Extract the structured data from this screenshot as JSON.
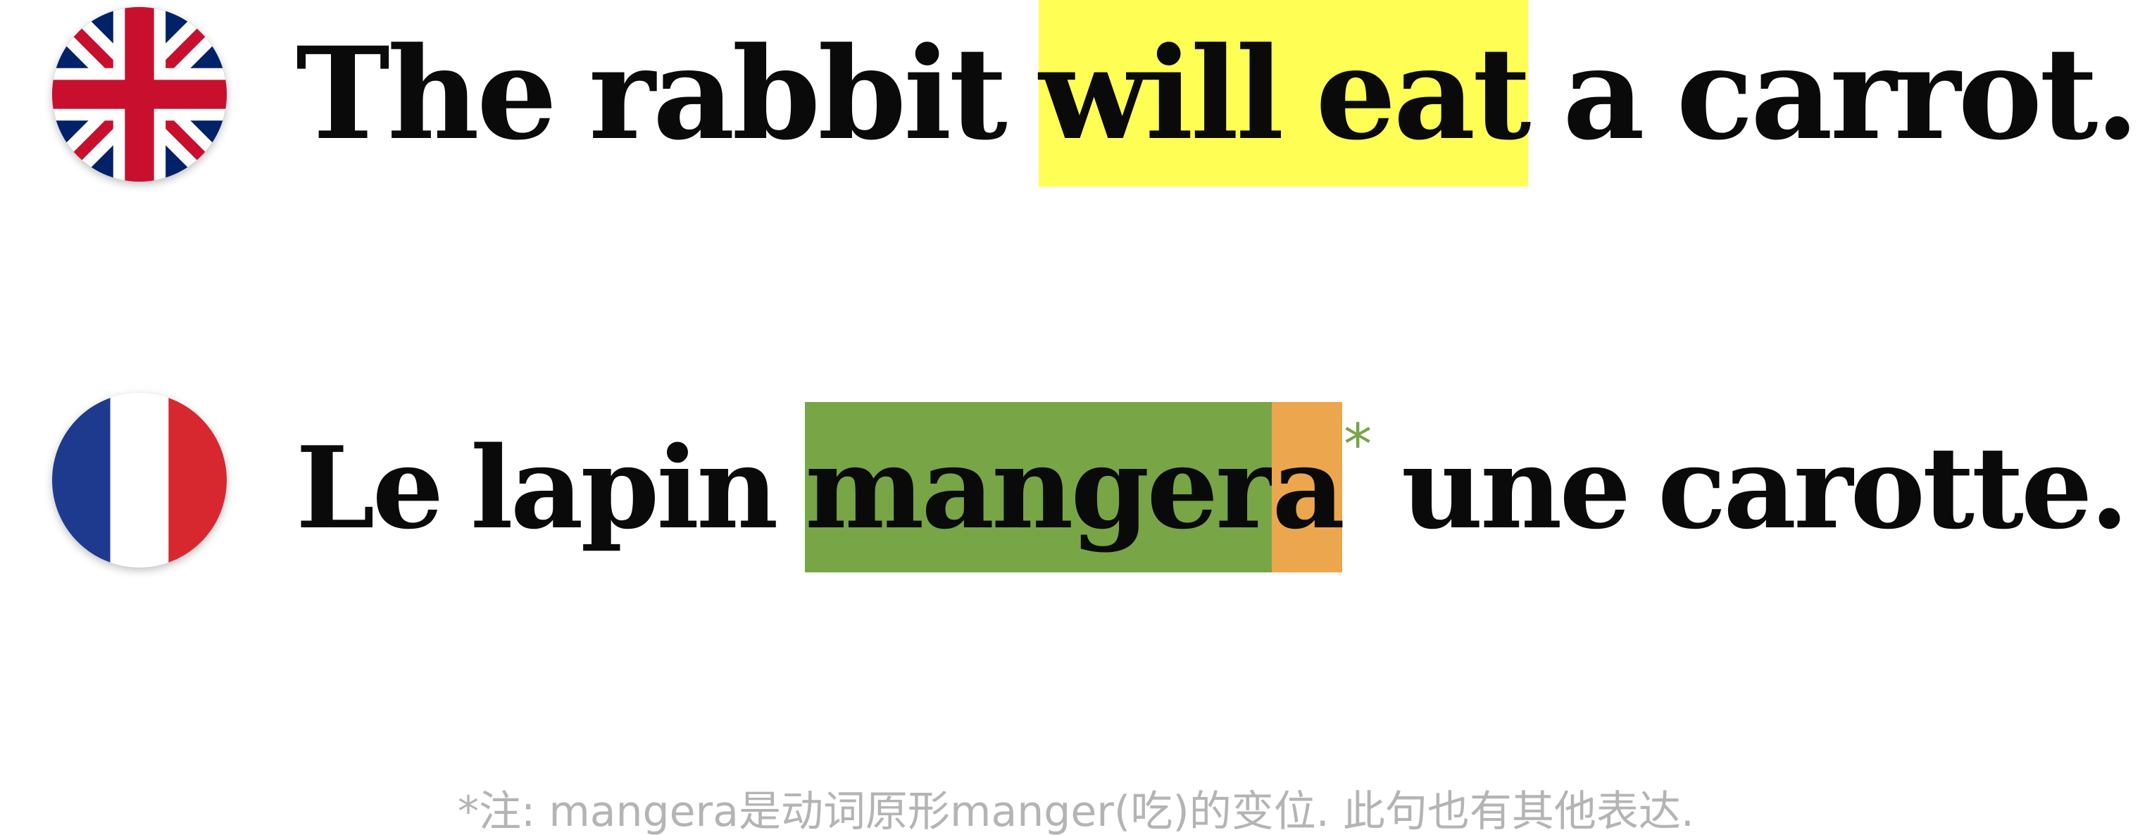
{
  "english": {
    "flag_icon": "uk-flag-icon",
    "before": "The rabbit ",
    "highlight": "will eat",
    "after": " a carrot."
  },
  "french": {
    "flag_icon": "france-flag-icon",
    "before": "Le lapin ",
    "stem": "manger",
    "ending": "a",
    "asterisk": "*",
    "after": " une carotte."
  },
  "footnote": "*注: mangera是动词原形manger(吃)的变位. 此句也有其他表达.",
  "colors": {
    "english_highlight": "#fffe55",
    "french_stem_highlight": "#78a545",
    "french_ending_highlight": "#eca64e",
    "asterisk": "#78a545",
    "footnote_text": "#b4b4b4"
  }
}
